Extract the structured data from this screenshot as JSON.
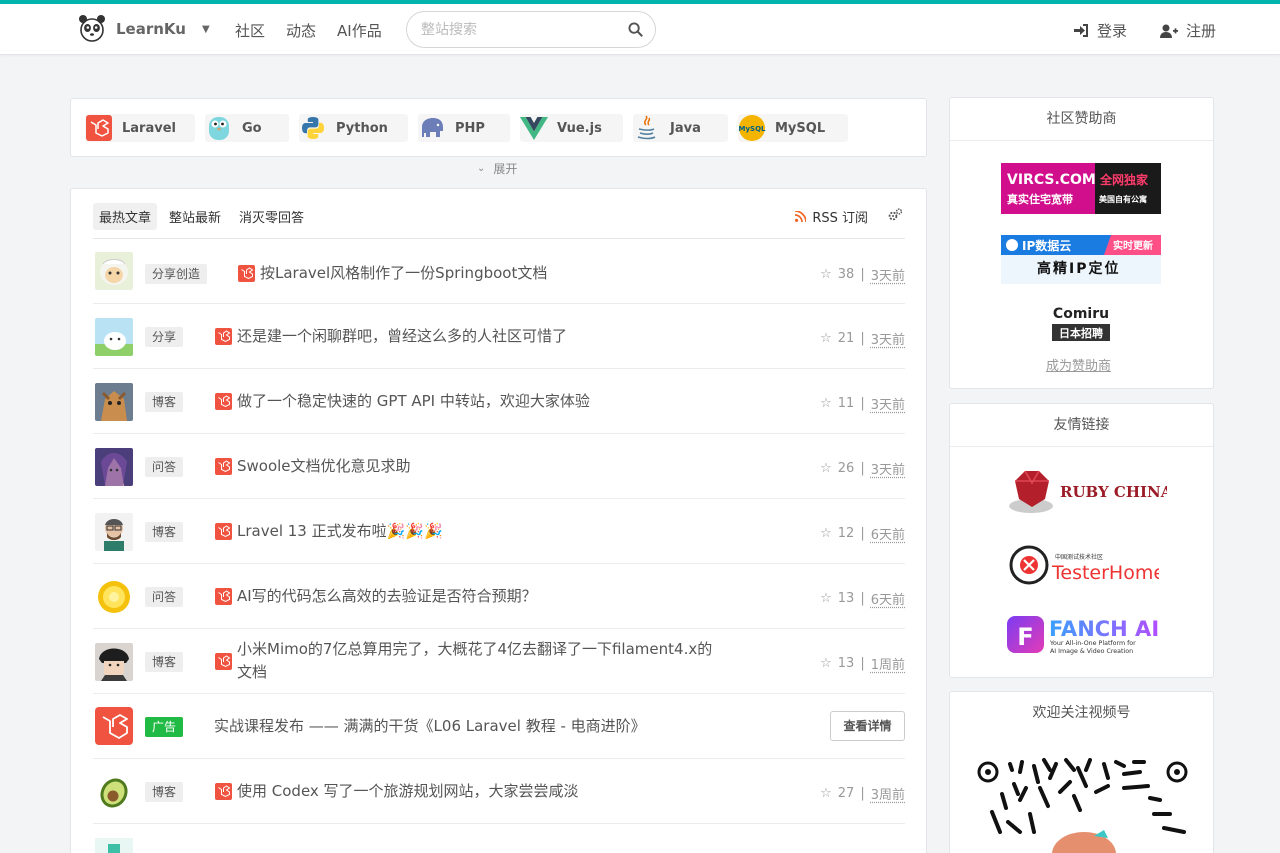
{
  "header": {
    "brand": "LearnKu",
    "nav": [
      "社区",
      "动态",
      "AI作品"
    ],
    "search_placeholder": "整站搜索",
    "login": "登录",
    "register": "注册"
  },
  "tags": {
    "items": [
      {
        "label": "Laravel",
        "icon": "laravel-icon"
      },
      {
        "label": "Go",
        "icon": "go-gopher-icon"
      },
      {
        "label": "Python",
        "icon": "python-icon"
      },
      {
        "label": "PHP",
        "icon": "php-elephant-icon"
      },
      {
        "label": "Vue.js",
        "icon": "vue-icon"
      },
      {
        "label": "Java",
        "icon": "java-cup-icon"
      },
      {
        "label": "MySQL",
        "icon": "mysql-icon"
      }
    ],
    "expand": "展开"
  },
  "topics": {
    "tabs": [
      "最热文章",
      "整站最新",
      "消灭零回答"
    ],
    "rss": "RSS 订阅",
    "rows": [
      {
        "label": "分享创造",
        "title": "按Laravel风格制作了一份Springboot文档",
        "stars": "38",
        "time": "3天前"
      },
      {
        "label": "分享",
        "title": "还是建一个闲聊群吧，曾经这么多的人社区可惜了",
        "stars": "21",
        "time": "3天前"
      },
      {
        "label": "博客",
        "title": "做了一个稳定快速的 GPT API 中转站，欢迎大家体验",
        "stars": "11",
        "time": "3天前"
      },
      {
        "label": "问答",
        "title": "Swoole文档优化意见求助",
        "stars": "26",
        "time": "3天前"
      },
      {
        "label": "博客",
        "title": "Lravel 13 正式发布啦🎉🎉🎉",
        "stars": "12",
        "time": "6天前"
      },
      {
        "label": "问答",
        "title": "AI写的代码怎么高效的去验证是否符合预期？",
        "stars": "13",
        "time": "6天前"
      },
      {
        "label": "博客",
        "title_line1": "小米Mimo的7亿总算用完了，大概花了4亿去翻译了一下filament4.x的",
        "title_line2": "文档",
        "stars": "13",
        "time": "1周前"
      },
      {
        "label": "广告",
        "title": "实战课程发布 —— 满满的干货《L06 Laravel 教程 - 电商进阶》",
        "button": "查看详情"
      },
      {
        "label": "博客",
        "title": "使用 Codex 写了一个旅游规划网站，大家尝尝咸淡",
        "stars": "27",
        "time": "3周前"
      }
    ],
    "separator": "|"
  },
  "sidebar": {
    "sponsors_title": "社区赞助商",
    "sponsor1_main": "VIRCS.COM",
    "sponsor1_badge": "全网独家",
    "sponsor1_line2": "真实住宅宽带",
    "sponsor1_line2b": "美国自有公寓",
    "sponsor2_main": "IP数据云",
    "sponsor2_badge": "实时更新",
    "sponsor2_line2": "高精IP定位",
    "sponsor3_main": "Comiru",
    "sponsor3_sub": "日本招聘",
    "become_sponsor": "成为赞助商",
    "links_title": "友情链接",
    "link1": "RUBY CHINA",
    "link2_small": "中国测试技术社区",
    "link2": "TesterHome",
    "link3": "FANCH AI",
    "link3_sub1": "Your All-in-One Platform for",
    "link3_sub2": "AI Image & Video Creation",
    "video_title": "欢迎关注视频号"
  },
  "colors": {
    "accent": "#00b5ad",
    "laravel": "#f05340",
    "ad": "#21ba45"
  }
}
